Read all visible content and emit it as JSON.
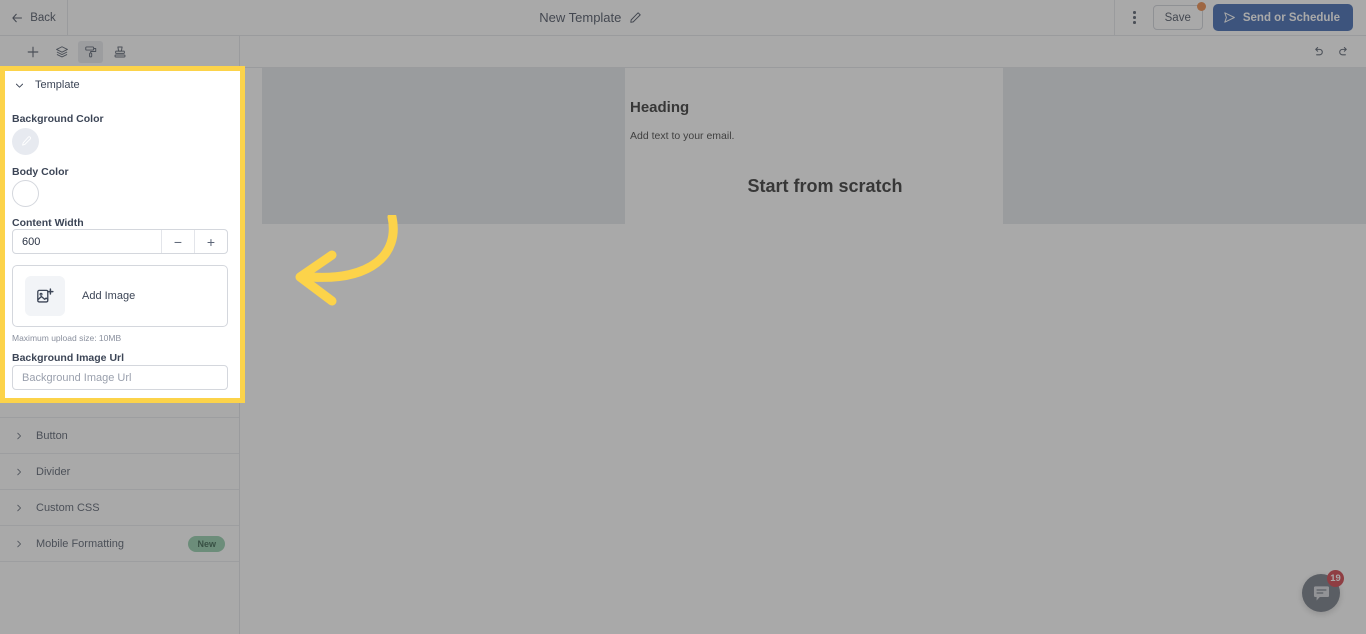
{
  "header": {
    "back_label": "Back",
    "back_icon": "arrow-left-icon",
    "title": "New Template",
    "edit_icon": "pencil-icon",
    "kebab_icon": "more-vertical-icon",
    "save_label": "Save",
    "save_has_unsaved_badge": true,
    "send_label": "Send or Schedule",
    "send_icon": "send-plane-icon",
    "send_button_color": "#1f4fa3",
    "unsaved_badge_color": "#e8762b"
  },
  "sidebar": {
    "toolbar": [
      {
        "name": "add-block-icon",
        "label": "Add",
        "active": false
      },
      {
        "name": "layers-icon",
        "label": "Layers",
        "active": false
      },
      {
        "name": "paint-roller-icon",
        "label": "Styles",
        "active": true
      },
      {
        "name": "stamp-icon",
        "label": "Brand",
        "active": false
      }
    ],
    "section": {
      "title": "Template",
      "chevron_icon": "chevron-down-icon",
      "expanded": true
    },
    "background_color": {
      "label": "Background Color",
      "swatch_icon": "eyedropper-icon",
      "swatch_color": "#e7eaf0"
    },
    "body_color": {
      "label": "Body Color",
      "swatch_color": "#ffffff"
    },
    "content_width": {
      "label": "Content Width",
      "value": "600",
      "decrement_label": "−",
      "increment_label": "+"
    },
    "add_image": {
      "label": "Add Image",
      "icon": "image-plus-icon",
      "hint": "Maximum upload size: 10MB"
    },
    "background_image_url": {
      "label": "Background Image Url",
      "value": "",
      "placeholder": "Background Image Url"
    },
    "accordion": [
      {
        "label": "Button",
        "chevron_icon": "chevron-right-icon",
        "badge": ""
      },
      {
        "label": "Divider",
        "chevron_icon": "chevron-right-icon",
        "badge": ""
      },
      {
        "label": "Custom CSS",
        "chevron_icon": "chevron-right-icon",
        "badge": ""
      },
      {
        "label": "Mobile Formatting",
        "chevron_icon": "chevron-right-icon",
        "badge": "New"
      }
    ],
    "badge_new_color": "#7fc49d"
  },
  "canvas": {
    "undo_icon": "undo-icon",
    "redo_icon": "redo-icon",
    "email": {
      "heading": "Heading",
      "subtext": "Add text to your email.",
      "scratch_title": "Start from scratch"
    }
  },
  "chat": {
    "icon": "chat-bubble-icon",
    "unread_count": "19",
    "badge_color": "#c8202a"
  },
  "annotation": {
    "highlight_color": "#fcd34a",
    "arrow_icon": "curved-arrow-left-icon"
  }
}
